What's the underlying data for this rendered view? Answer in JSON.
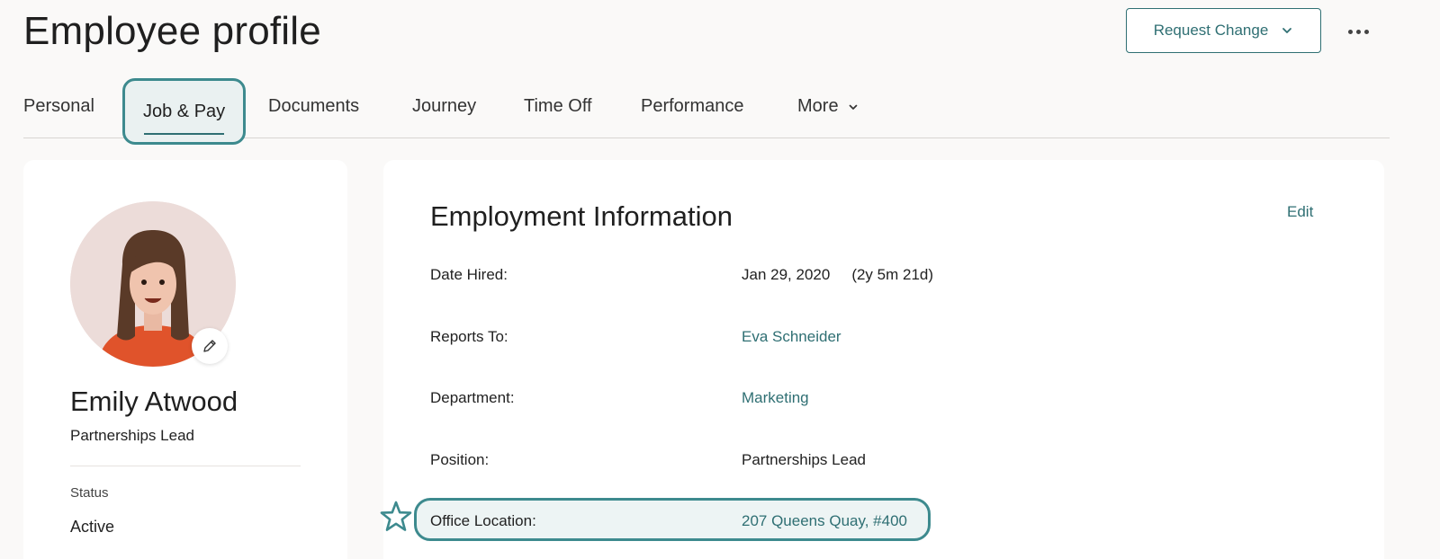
{
  "header": {
    "title": "Employee profile",
    "request_change_label": "Request Change",
    "more_actions_icon": "ellipsis-icon"
  },
  "tabs": [
    {
      "label": "Personal"
    },
    {
      "label": "Job & Pay",
      "active": true
    },
    {
      "label": "Documents"
    },
    {
      "label": "Journey"
    },
    {
      "label": "Time Off"
    },
    {
      "label": "Performance"
    },
    {
      "label": "More"
    }
  ],
  "profile": {
    "name": "Emily Atwood",
    "role": "Partnerships Lead",
    "status_label": "Status",
    "status_value": "Active"
  },
  "employment": {
    "title": "Employment Information",
    "edit_label": "Edit",
    "fields": [
      {
        "label": "Date Hired:",
        "value": "Jan 29, 2020",
        "extra": "(2y 5m 21d)"
      },
      {
        "label": "Reports To:",
        "value": "Eva Schneider"
      },
      {
        "label": "Department:",
        "value": "Marketing"
      },
      {
        "label": "Position:",
        "value": "Partnerships Lead"
      },
      {
        "label": "Office Location:",
        "value": "207 Queens Quay, #400"
      }
    ]
  },
  "colors": {
    "accent": "#2f6f73",
    "highlight_border": "#3d8a8e",
    "background": "#faf9f8"
  }
}
